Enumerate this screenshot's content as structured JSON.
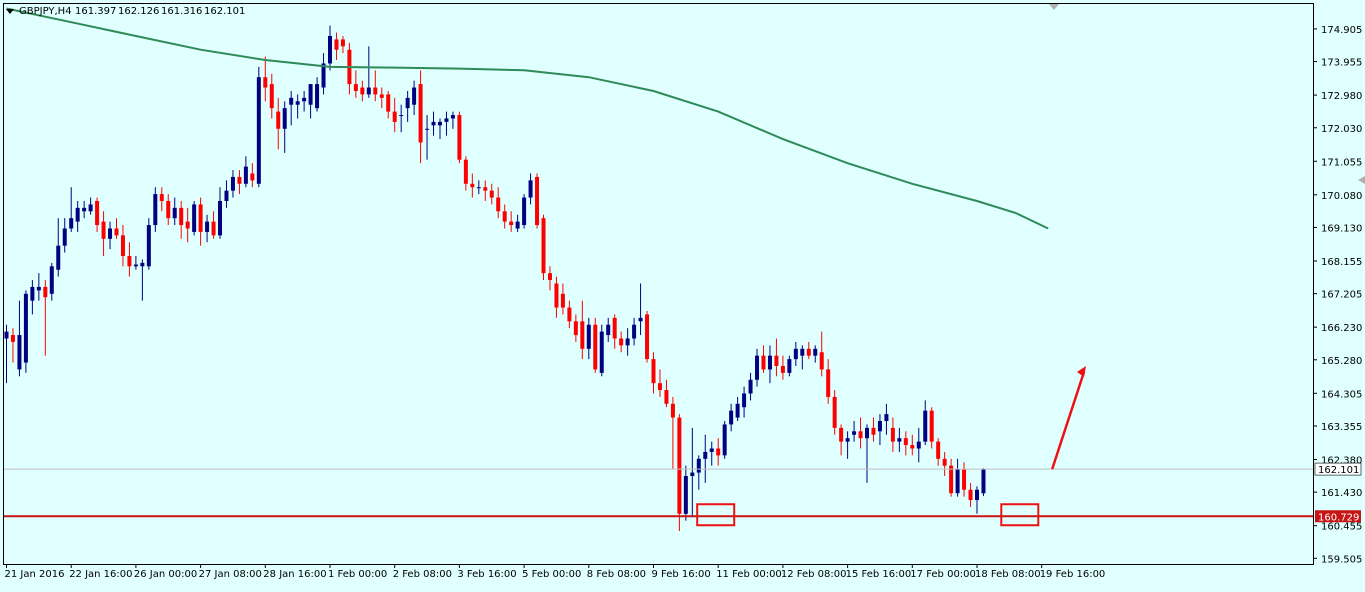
{
  "chart_data": {
    "type": "candlestick",
    "symbol_info": {
      "symbol": "GBPJPY,H4",
      "open": "161.397",
      "high": "162.126",
      "low": "161.316",
      "close": "162.101"
    },
    "y_ticks": [
      "174.905",
      "173.955",
      "172.980",
      "172.030",
      "171.055",
      "170.080",
      "169.130",
      "168.155",
      "167.205",
      "166.230",
      "165.280",
      "164.305",
      "163.355",
      "162.380",
      "161.430",
      "160.455",
      "159.505"
    ],
    "ylim": [
      159.34,
      175.63
    ],
    "x_ticks": [
      "21 Jan 2016",
      "22 Jan 16:00",
      "26 Jan 00:00",
      "27 Jan 08:00",
      "28 Jan 16:00",
      "1 Feb 00:00",
      "2 Feb 08:00",
      "3 Feb 16:00",
      "5 Feb 00:00",
      "8 Feb 08:00",
      "9 Feb 16:00",
      "11 Feb 00:00",
      "12 Feb 08:00",
      "15 Feb 16:00",
      "17 Feb 00:00",
      "18 Feb 08:00",
      "19 Feb 16:00"
    ],
    "current_price": {
      "label": "162.101",
      "value": 162.101,
      "line_color": "#c0c0c0",
      "label_bg": "#ffffff"
    },
    "support_level": {
      "label": "160.729",
      "value": 160.729,
      "color": "#c81414"
    },
    "colors": {
      "bull": "#000080",
      "bear": "#ff0000",
      "ma": "#2e8b57",
      "background": "#e0ffff",
      "annotation": "#ee1111"
    },
    "moving_average": [
      {
        "i": 0,
        "v": 175.5
      },
      {
        "i": 10,
        "v": 175.1
      },
      {
        "i": 20,
        "v": 174.7
      },
      {
        "i": 30,
        "v": 174.3
      },
      {
        "i": 40,
        "v": 174.0
      },
      {
        "i": 50,
        "v": 173.8
      },
      {
        "i": 60,
        "v": 173.78
      },
      {
        "i": 70,
        "v": 173.75
      },
      {
        "i": 80,
        "v": 173.7
      },
      {
        "i": 90,
        "v": 173.5
      },
      {
        "i": 100,
        "v": 173.1
      },
      {
        "i": 110,
        "v": 172.5
      },
      {
        "i": 120,
        "v": 171.7
      },
      {
        "i": 130,
        "v": 171.0
      },
      {
        "i": 140,
        "v": 170.4
      },
      {
        "i": 150,
        "v": 169.9
      },
      {
        "i": 156,
        "v": 169.55
      },
      {
        "i": 161,
        "v": 169.1
      }
    ],
    "candles": [
      {
        "o": 165.9,
        "h": 166.3,
        "l": 164.6,
        "c": 166.1
      },
      {
        "o": 166.0,
        "h": 166.2,
        "l": 165.2,
        "c": 165.8
      },
      {
        "o": 165.0,
        "h": 167.0,
        "l": 164.8,
        "c": 166.0
      },
      {
        "o": 165.2,
        "h": 167.3,
        "l": 164.9,
        "c": 167.2
      },
      {
        "o": 167.0,
        "h": 167.6,
        "l": 166.6,
        "c": 167.4
      },
      {
        "o": 167.3,
        "h": 167.8,
        "l": 167.0,
        "c": 167.4
      },
      {
        "o": 167.4,
        "h": 167.6,
        "l": 165.4,
        "c": 167.1
      },
      {
        "o": 167.2,
        "h": 168.1,
        "l": 167.0,
        "c": 168.0
      },
      {
        "o": 167.9,
        "h": 169.4,
        "l": 167.7,
        "c": 168.6
      },
      {
        "o": 168.6,
        "h": 169.4,
        "l": 168.4,
        "c": 169.1
      },
      {
        "o": 169.1,
        "h": 170.3,
        "l": 169.0,
        "c": 169.4
      },
      {
        "o": 169.3,
        "h": 169.9,
        "l": 169.0,
        "c": 169.7
      },
      {
        "o": 169.6,
        "h": 169.9,
        "l": 169.4,
        "c": 169.7
      },
      {
        "o": 169.6,
        "h": 170.0,
        "l": 169.5,
        "c": 169.8
      },
      {
        "o": 169.9,
        "h": 170.0,
        "l": 169.0,
        "c": 169.2
      },
      {
        "o": 169.3,
        "h": 169.6,
        "l": 168.3,
        "c": 168.8
      },
      {
        "o": 168.8,
        "h": 169.3,
        "l": 168.5,
        "c": 169.1
      },
      {
        "o": 169.1,
        "h": 169.4,
        "l": 168.8,
        "c": 168.9
      },
      {
        "o": 168.9,
        "h": 169.2,
        "l": 168.0,
        "c": 168.3
      },
      {
        "o": 168.3,
        "h": 168.7,
        "l": 167.7,
        "c": 168.0
      },
      {
        "o": 168.0,
        "h": 168.3,
        "l": 167.9,
        "c": 168.05
      },
      {
        "o": 168.0,
        "h": 168.2,
        "l": 167.0,
        "c": 168.1
      },
      {
        "o": 168.0,
        "h": 169.4,
        "l": 167.9,
        "c": 169.2
      },
      {
        "o": 169.2,
        "h": 170.3,
        "l": 169.0,
        "c": 170.1
      },
      {
        "o": 170.1,
        "h": 170.3,
        "l": 169.6,
        "c": 169.9
      },
      {
        "o": 169.9,
        "h": 170.1,
        "l": 169.2,
        "c": 169.4
      },
      {
        "o": 169.4,
        "h": 170.0,
        "l": 169.2,
        "c": 169.7
      },
      {
        "o": 169.7,
        "h": 169.9,
        "l": 168.8,
        "c": 169.2
      },
      {
        "o": 169.3,
        "h": 169.7,
        "l": 168.7,
        "c": 169.1
      },
      {
        "o": 169.0,
        "h": 169.9,
        "l": 168.9,
        "c": 169.8
      },
      {
        "o": 169.8,
        "h": 170.0,
        "l": 168.6,
        "c": 169.0
      },
      {
        "o": 169.0,
        "h": 169.5,
        "l": 168.7,
        "c": 169.3
      },
      {
        "o": 169.3,
        "h": 169.6,
        "l": 168.8,
        "c": 168.9
      },
      {
        "o": 168.9,
        "h": 170.3,
        "l": 168.8,
        "c": 169.9
      },
      {
        "o": 169.9,
        "h": 170.5,
        "l": 169.7,
        "c": 170.2
      },
      {
        "o": 170.2,
        "h": 170.8,
        "l": 170.0,
        "c": 170.6
      },
      {
        "o": 170.6,
        "h": 170.8,
        "l": 170.1,
        "c": 170.4
      },
      {
        "o": 170.4,
        "h": 171.2,
        "l": 170.3,
        "c": 170.9
      },
      {
        "o": 170.7,
        "h": 171.0,
        "l": 170.3,
        "c": 170.5
      },
      {
        "o": 170.4,
        "h": 173.8,
        "l": 170.3,
        "c": 173.5
      },
      {
        "o": 173.5,
        "h": 174.1,
        "l": 172.8,
        "c": 173.2
      },
      {
        "o": 173.3,
        "h": 173.6,
        "l": 172.3,
        "c": 172.6
      },
      {
        "o": 172.5,
        "h": 172.9,
        "l": 171.4,
        "c": 172.0
      },
      {
        "o": 172.0,
        "h": 172.8,
        "l": 171.3,
        "c": 172.6
      },
      {
        "o": 172.7,
        "h": 173.1,
        "l": 172.1,
        "c": 172.9
      },
      {
        "o": 172.7,
        "h": 173.0,
        "l": 172.3,
        "c": 172.8
      },
      {
        "o": 172.8,
        "h": 173.1,
        "l": 172.5,
        "c": 172.9
      },
      {
        "o": 172.7,
        "h": 173.3,
        "l": 172.3,
        "c": 173.3
      },
      {
        "o": 172.6,
        "h": 173.5,
        "l": 172.5,
        "c": 173.3
      },
      {
        "o": 173.2,
        "h": 174.2,
        "l": 173.0,
        "c": 173.9
      },
      {
        "o": 173.9,
        "h": 175.0,
        "l": 173.7,
        "c": 174.7
      },
      {
        "o": 174.6,
        "h": 174.8,
        "l": 174.0,
        "c": 174.3
      },
      {
        "o": 174.6,
        "h": 174.7,
        "l": 174.2,
        "c": 174.4
      },
      {
        "o": 174.3,
        "h": 174.5,
        "l": 173.0,
        "c": 173.3
      },
      {
        "o": 173.3,
        "h": 173.7,
        "l": 172.9,
        "c": 173.1
      },
      {
        "o": 173.2,
        "h": 173.4,
        "l": 172.8,
        "c": 173.0
      },
      {
        "o": 173.0,
        "h": 174.4,
        "l": 172.9,
        "c": 173.2
      },
      {
        "o": 173.2,
        "h": 173.7,
        "l": 172.8,
        "c": 173.0
      },
      {
        "o": 173.0,
        "h": 173.2,
        "l": 172.6,
        "c": 172.9
      },
      {
        "o": 173.0,
        "h": 173.1,
        "l": 172.3,
        "c": 172.5
      },
      {
        "o": 172.5,
        "h": 172.9,
        "l": 171.9,
        "c": 172.2
      },
      {
        "o": 172.4,
        "h": 172.7,
        "l": 171.9,
        "c": 172.4
      },
      {
        "o": 172.6,
        "h": 173.1,
        "l": 172.2,
        "c": 172.9
      },
      {
        "o": 172.7,
        "h": 173.4,
        "l": 172.4,
        "c": 173.2
      },
      {
        "o": 173.3,
        "h": 173.7,
        "l": 171.0,
        "c": 171.6
      },
      {
        "o": 172.0,
        "h": 172.4,
        "l": 171.1,
        "c": 172.0
      },
      {
        "o": 172.1,
        "h": 172.5,
        "l": 171.8,
        "c": 172.2
      },
      {
        "o": 172.1,
        "h": 172.3,
        "l": 171.7,
        "c": 172.2
      },
      {
        "o": 172.2,
        "h": 172.5,
        "l": 171.8,
        "c": 172.3
      },
      {
        "o": 172.3,
        "h": 172.5,
        "l": 172.0,
        "c": 172.4
      },
      {
        "o": 172.4,
        "h": 172.5,
        "l": 171.0,
        "c": 171.1
      },
      {
        "o": 171.1,
        "h": 171.2,
        "l": 170.2,
        "c": 170.4
      },
      {
        "o": 170.4,
        "h": 170.7,
        "l": 170.0,
        "c": 170.3
      },
      {
        "o": 170.3,
        "h": 170.5,
        "l": 170.1,
        "c": 170.3
      },
      {
        "o": 170.3,
        "h": 170.5,
        "l": 169.9,
        "c": 170.2
      },
      {
        "o": 170.2,
        "h": 170.4,
        "l": 169.8,
        "c": 170.0
      },
      {
        "o": 170.0,
        "h": 170.3,
        "l": 169.4,
        "c": 169.6
      },
      {
        "o": 169.6,
        "h": 169.8,
        "l": 169.1,
        "c": 169.3
      },
      {
        "o": 169.3,
        "h": 169.6,
        "l": 169.0,
        "c": 169.2
      },
      {
        "o": 169.1,
        "h": 169.5,
        "l": 169.0,
        "c": 169.3
      },
      {
        "o": 169.2,
        "h": 170.1,
        "l": 169.1,
        "c": 170.0
      },
      {
        "o": 170.0,
        "h": 170.7,
        "l": 169.8,
        "c": 170.5
      },
      {
        "o": 170.6,
        "h": 170.7,
        "l": 169.1,
        "c": 169.2
      },
      {
        "o": 169.4,
        "h": 169.5,
        "l": 167.6,
        "c": 167.8
      },
      {
        "o": 167.8,
        "h": 168.0,
        "l": 167.3,
        "c": 167.6
      },
      {
        "o": 167.5,
        "h": 167.7,
        "l": 166.5,
        "c": 166.8
      },
      {
        "o": 167.2,
        "h": 167.5,
        "l": 166.6,
        "c": 166.8
      },
      {
        "o": 166.8,
        "h": 167.0,
        "l": 166.2,
        "c": 166.4
      },
      {
        "o": 166.4,
        "h": 166.6,
        "l": 165.8,
        "c": 166.0
      },
      {
        "o": 166.4,
        "h": 167.0,
        "l": 165.3,
        "c": 165.6
      },
      {
        "o": 165.6,
        "h": 166.5,
        "l": 165.3,
        "c": 166.3
      },
      {
        "o": 166.3,
        "h": 166.5,
        "l": 164.9,
        "c": 165.0
      },
      {
        "o": 164.9,
        "h": 166.3,
        "l": 164.8,
        "c": 166.1
      },
      {
        "o": 166.0,
        "h": 166.5,
        "l": 165.8,
        "c": 166.3
      },
      {
        "o": 166.5,
        "h": 166.6,
        "l": 165.6,
        "c": 165.9
      },
      {
        "o": 165.9,
        "h": 166.1,
        "l": 165.5,
        "c": 165.7
      },
      {
        "o": 165.7,
        "h": 166.2,
        "l": 165.4,
        "c": 165.9
      },
      {
        "o": 165.9,
        "h": 166.5,
        "l": 165.7,
        "c": 166.3
      },
      {
        "o": 166.4,
        "h": 167.5,
        "l": 166.0,
        "c": 166.5
      },
      {
        "o": 166.6,
        "h": 166.7,
        "l": 165.2,
        "c": 165.3
      },
      {
        "o": 165.3,
        "h": 165.5,
        "l": 164.3,
        "c": 164.6
      },
      {
        "o": 164.6,
        "h": 165.0,
        "l": 164.2,
        "c": 164.4
      },
      {
        "o": 164.4,
        "h": 164.7,
        "l": 163.9,
        "c": 164.0
      },
      {
        "o": 164.0,
        "h": 164.2,
        "l": 162.1,
        "c": 163.6
      },
      {
        "o": 163.6,
        "h": 163.7,
        "l": 160.3,
        "c": 160.8
      },
      {
        "o": 160.8,
        "h": 162.2,
        "l": 160.6,
        "c": 161.9
      },
      {
        "o": 161.9,
        "h": 163.3,
        "l": 160.7,
        "c": 162.0
      },
      {
        "o": 162.0,
        "h": 162.5,
        "l": 161.5,
        "c": 162.4
      },
      {
        "o": 162.4,
        "h": 163.1,
        "l": 161.7,
        "c": 162.6
      },
      {
        "o": 162.6,
        "h": 162.9,
        "l": 162.2,
        "c": 162.7
      },
      {
        "o": 162.7,
        "h": 163.0,
        "l": 162.2,
        "c": 162.5
      },
      {
        "o": 162.5,
        "h": 163.5,
        "l": 162.4,
        "c": 163.4
      },
      {
        "o": 163.4,
        "h": 164.0,
        "l": 163.2,
        "c": 163.8
      },
      {
        "o": 163.6,
        "h": 164.2,
        "l": 163.5,
        "c": 164.0
      },
      {
        "o": 163.9,
        "h": 164.5,
        "l": 163.6,
        "c": 164.3
      },
      {
        "o": 164.3,
        "h": 164.9,
        "l": 164.1,
        "c": 164.7
      },
      {
        "o": 164.7,
        "h": 165.6,
        "l": 164.5,
        "c": 165.4
      },
      {
        "o": 165.4,
        "h": 165.7,
        "l": 164.9,
        "c": 165.0
      },
      {
        "o": 165.0,
        "h": 165.7,
        "l": 164.6,
        "c": 165.4
      },
      {
        "o": 165.4,
        "h": 165.9,
        "l": 164.8,
        "c": 165.1
      },
      {
        "o": 165.1,
        "h": 165.4,
        "l": 164.7,
        "c": 164.9
      },
      {
        "o": 164.9,
        "h": 165.4,
        "l": 164.8,
        "c": 165.3
      },
      {
        "o": 165.3,
        "h": 165.8,
        "l": 165.1,
        "c": 165.6
      },
      {
        "o": 165.4,
        "h": 165.7,
        "l": 165.0,
        "c": 165.6
      },
      {
        "o": 165.6,
        "h": 165.8,
        "l": 165.3,
        "c": 165.4
      },
      {
        "o": 165.4,
        "h": 165.7,
        "l": 165.2,
        "c": 165.6
      },
      {
        "o": 165.5,
        "h": 166.1,
        "l": 164.8,
        "c": 165.0
      },
      {
        "o": 165.0,
        "h": 165.3,
        "l": 164.0,
        "c": 164.2
      },
      {
        "o": 164.2,
        "h": 164.4,
        "l": 163.1,
        "c": 163.3
      },
      {
        "o": 163.3,
        "h": 163.4,
        "l": 162.5,
        "c": 162.9
      },
      {
        "o": 162.9,
        "h": 163.2,
        "l": 162.4,
        "c": 163.0
      },
      {
        "o": 163.1,
        "h": 163.5,
        "l": 162.9,
        "c": 163.2
      },
      {
        "o": 163.2,
        "h": 163.6,
        "l": 162.7,
        "c": 163.0
      },
      {
        "o": 163.0,
        "h": 163.4,
        "l": 161.7,
        "c": 163.3
      },
      {
        "o": 163.3,
        "h": 163.6,
        "l": 162.9,
        "c": 163.1
      },
      {
        "o": 163.2,
        "h": 163.7,
        "l": 162.8,
        "c": 163.5
      },
      {
        "o": 163.5,
        "h": 164.0,
        "l": 163.1,
        "c": 163.7
      },
      {
        "o": 163.3,
        "h": 163.6,
        "l": 162.6,
        "c": 162.9
      },
      {
        "o": 162.9,
        "h": 163.3,
        "l": 162.6,
        "c": 163.0
      },
      {
        "o": 163.0,
        "h": 163.2,
        "l": 162.5,
        "c": 162.8
      },
      {
        "o": 162.8,
        "h": 163.1,
        "l": 162.5,
        "c": 162.7
      },
      {
        "o": 162.7,
        "h": 163.3,
        "l": 162.3,
        "c": 162.9
      },
      {
        "o": 162.9,
        "h": 164.1,
        "l": 162.8,
        "c": 163.8
      },
      {
        "o": 163.8,
        "h": 163.9,
        "l": 162.7,
        "c": 162.9
      },
      {
        "o": 162.9,
        "h": 163.0,
        "l": 162.2,
        "c": 162.4
      },
      {
        "o": 162.4,
        "h": 162.6,
        "l": 161.9,
        "c": 162.2
      },
      {
        "o": 162.2,
        "h": 162.4,
        "l": 161.3,
        "c": 161.4
      },
      {
        "o": 161.4,
        "h": 162.4,
        "l": 161.3,
        "c": 162.1
      },
      {
        "o": 162.1,
        "h": 162.3,
        "l": 161.3,
        "c": 161.5
      },
      {
        "o": 161.5,
        "h": 161.7,
        "l": 161.0,
        "c": 161.2
      },
      {
        "o": 161.2,
        "h": 161.6,
        "l": 160.8,
        "c": 161.5
      },
      {
        "o": 161.397,
        "h": 162.126,
        "l": 161.316,
        "c": 162.101
      }
    ]
  }
}
